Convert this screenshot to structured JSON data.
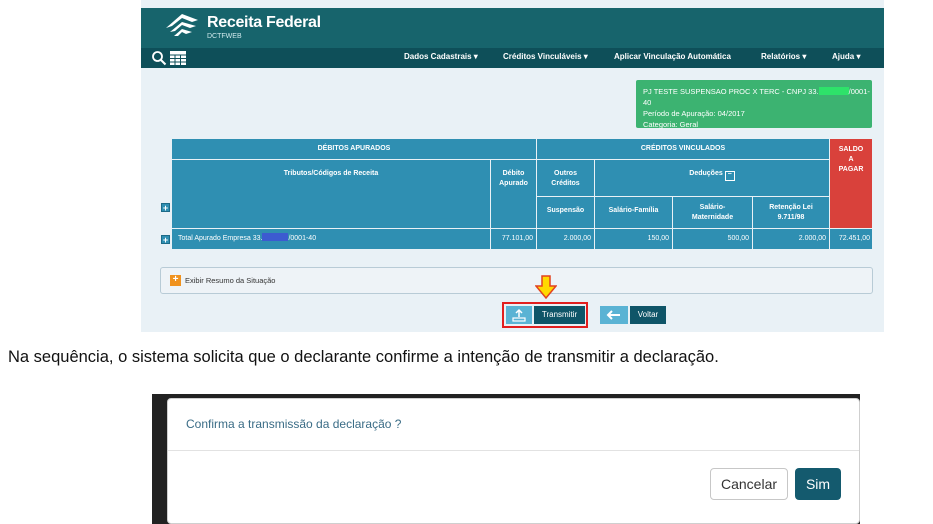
{
  "header": {
    "brand": "Receita Federal",
    "brand_sub": "DCTFWEB"
  },
  "nav": {
    "items": [
      "Dados Cadastrais ▾",
      "Créditos Vinculáveis ▾",
      "Aplicar Vinculação Automática",
      "Relatórios ▾",
      "Ajuda ▾"
    ]
  },
  "info": {
    "line1_prefix": "PJ TESTE SUSPENSAO PROC X TERC - CNPJ 33.",
    "line1_suffix": "/0001-40",
    "line2": "Período de Apuração: 04/2017",
    "line3": "Categoria: Geral"
  },
  "table": {
    "debitos_header": "DÉBITOS APURADOS",
    "creditos_header": "CRÉDITOS VINCULADOS",
    "saldo_header": "SALDO A PAGAR",
    "col_tributos": "Tributos/Códigos de Receita",
    "col_debito": "Débito Apurado",
    "col_outros": "Outros Créditos",
    "col_deducoes": "Deduções",
    "col_suspensao": "Suspensão",
    "col_salfam": "Salário-Família",
    "col_salmat": "Salário-Maternidade",
    "col_retencao": "Retenção Lei 9.711/98",
    "total_label_prefix": "Total Apurado Empresa 33.",
    "total_label_suffix": "/0001-40",
    "total_debito": "77.101,00",
    "total_suspensao": "2.000,00",
    "total_salfam": "150,00",
    "total_salmat": "500,00",
    "total_retencao": "2.000,00",
    "total_saldo": "72.451,00"
  },
  "resumo": {
    "label": "Exibir Resumo da Situação"
  },
  "actions": {
    "transmit": "Transmitir",
    "back": "Voltar"
  },
  "caption": "Na sequência, o sistema solicita que o declarante confirme a intenção de transmitir a declaração.",
  "dialog": {
    "title": "Confirma a transmissão da declaração ?",
    "cancel": "Cancelar",
    "confirm": "Sim"
  },
  "colors": {
    "teal": "#17646c",
    "blue": "#2f8fb2",
    "green": "#3cb371",
    "red": "#d9413b",
    "highlight": "#e21f1f"
  }
}
